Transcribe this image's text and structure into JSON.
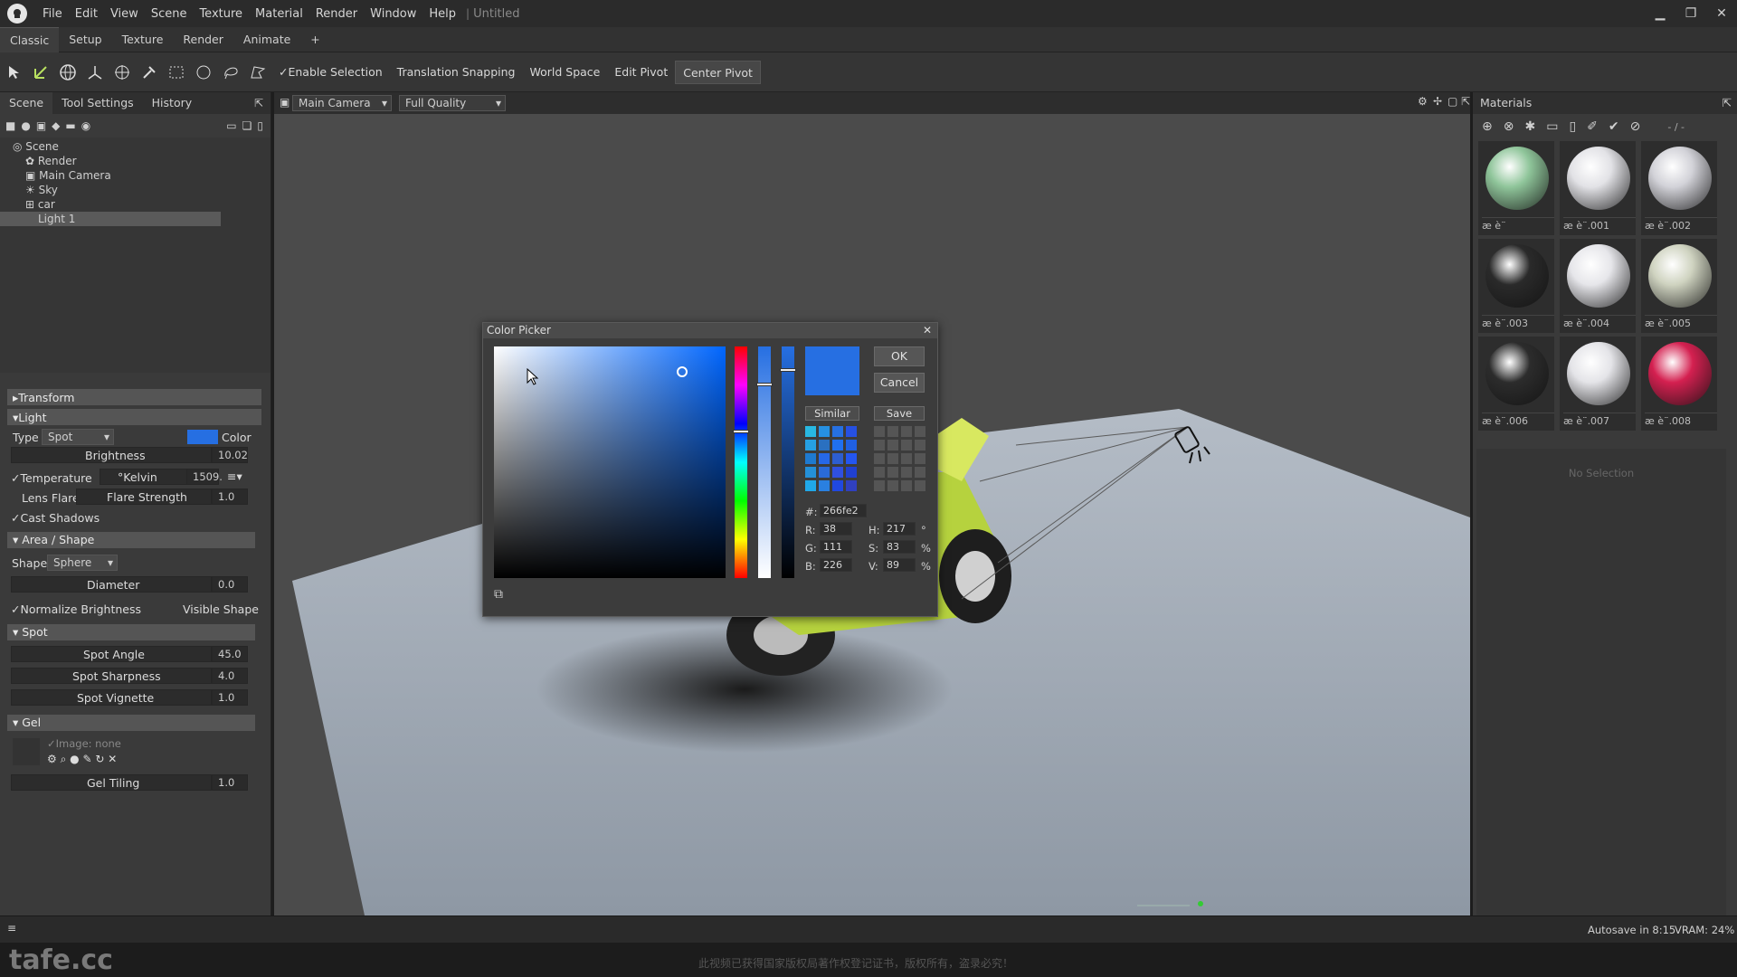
{
  "menubar": {
    "items": [
      "File",
      "Edit",
      "View",
      "Scene",
      "Texture",
      "Material",
      "Render",
      "Window",
      "Help"
    ],
    "document": "Untitled"
  },
  "tabs": [
    "Classic",
    "Setup",
    "Texture",
    "Render",
    "Animate",
    "+"
  ],
  "toolbar": {
    "enable_selection": "Enable Selection",
    "translation_snapping": "Translation Snapping",
    "world_space": "World Space",
    "edit_pivot": "Edit Pivot",
    "center_pivot": "Center Pivot"
  },
  "left_tabs": [
    "Scene",
    "Tool Settings",
    "History"
  ],
  "tree": [
    "Scene",
    "Render",
    "Main Camera",
    "Sky",
    "car",
    "Light 1"
  ],
  "light": {
    "transform": "Transform",
    "light": "Light",
    "type_label": "Type",
    "type_value": "Spot",
    "color_label": "Color",
    "color": "#266fe2",
    "brightness_label": "Brightness",
    "brightness": "10.02",
    "temperature_label": "Temperature",
    "kelvin_label": "°Kelvin",
    "kelvin": "1509.",
    "lens_flare": "Lens Flare",
    "flare_strength": "Flare Strength",
    "flare_value": "1.0",
    "cast_shadows": "Cast Shadows",
    "area_shape": "Area / Shape",
    "shape_label": "Shape",
    "shape_value": "Sphere",
    "diameter_label": "Diameter",
    "diameter": "0.0",
    "normalize": "Normalize Brightness",
    "visible_shape": "Visible Shape",
    "spot": "Spot",
    "spot_angle_label": "Spot Angle",
    "spot_angle": "45.0",
    "spot_sharp_label": "Spot Sharpness",
    "spot_sharp": "4.0",
    "spot_vig_label": "Spot Vignette",
    "spot_vig": "1.0",
    "gel": "Gel",
    "gel_image": "Image: none",
    "gel_tiling_label": "Gel Tiling",
    "gel_tiling": "1.0"
  },
  "viewport": {
    "camera": "Main Camera",
    "quality": "Full Quality"
  },
  "materials": {
    "title": "Materials",
    "filter": "- / -",
    "no_selection": "No Selection",
    "items": [
      {
        "label": "æ   è¨",
        "color": "#8fc59a"
      },
      {
        "label": "æ   è¨.001",
        "color": "#e2e2e6"
      },
      {
        "label": "æ   è¨.002",
        "color": "#d2d2d8"
      },
      {
        "label": "æ   è¨.003",
        "color": "#2a2a2a"
      },
      {
        "label": "æ   è¨.004",
        "color": "#e6e6ea"
      },
      {
        "label": "æ   è¨.005",
        "color": "#cfd3c0"
      },
      {
        "label": "æ   è¨.006",
        "color": "#2c2c2c"
      },
      {
        "label": "æ   è¨.007",
        "color": "#e4e4e8"
      },
      {
        "label": "æ   è¨.008",
        "color": "#d42050"
      }
    ]
  },
  "color_picker": {
    "title": "Color Picker",
    "ok": "OK",
    "cancel": "Cancel",
    "similar": "Similar",
    "save": "Save",
    "hex_label": "#:",
    "hex": "266fe2",
    "r_label": "R:",
    "r": "38",
    "g_label": "G:",
    "g": "111",
    "b_label": "B:",
    "b": "226",
    "h_label": "H:",
    "h": "217",
    "h_unit": "°",
    "s_label": "S:",
    "s": "83",
    "s_unit": "%",
    "v_label": "V:",
    "v": "89",
    "v_unit": "%",
    "current_color": "#266fe2",
    "similar_colors": [
      "#28b8e2",
      "#2690e2",
      "#2670e2",
      "#2650e2",
      "#26a0e2",
      "#2a70c0",
      "#2070f0",
      "#2060e2",
      "#1e7ad0",
      "#2668e8",
      "#2d5ed0",
      "#2456f0",
      "#2490d8",
      "#2a6ad8",
      "#3050e0",
      "#2040d0",
      "#20a8e8",
      "#2a80e0",
      "#2048e0",
      "#3040c0",
      "#2a50f0",
      "#26c8e8",
      "#3050e8",
      "#2a90e2"
    ]
  },
  "status": {
    "autosave": "Autosave in 8:15",
    "vram": "VRAM: 24%"
  },
  "watermark": {
    "brand": "tafe.cc",
    "notice": "此视频已获得国家版权局著作权登记证书，版权所有，盗录必究！"
  }
}
